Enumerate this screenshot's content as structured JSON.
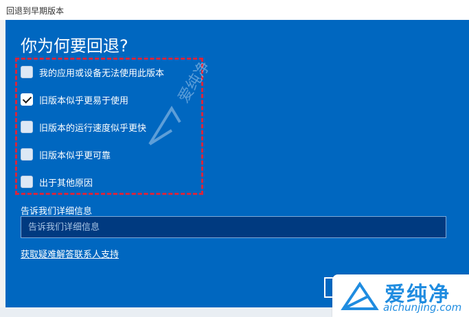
{
  "window": {
    "title": "回退到早期版本"
  },
  "main": {
    "heading": "你为何要回退?",
    "reasons": [
      {
        "label": "我的应用或设备无法使用此版本",
        "checked": false
      },
      {
        "label": "旧版本似乎更易于使用",
        "checked": true
      },
      {
        "label": "旧版本的运行速度似乎更快",
        "checked": false
      },
      {
        "label": "旧版本似乎更可靠",
        "checked": false
      },
      {
        "label": "出于其他原因",
        "checked": false
      }
    ],
    "details_label": "告诉我们详细信息",
    "details_placeholder": "告诉我们详细信息",
    "help_link": "获取疑难解答联系人支持"
  },
  "watermark": {
    "brand": "爱纯净",
    "domain": "aichunjing.com"
  },
  "colors": {
    "panel": "#0067c0",
    "input": "#003a80",
    "annotation": "#d7263d",
    "brand": "#1f8ce0"
  }
}
